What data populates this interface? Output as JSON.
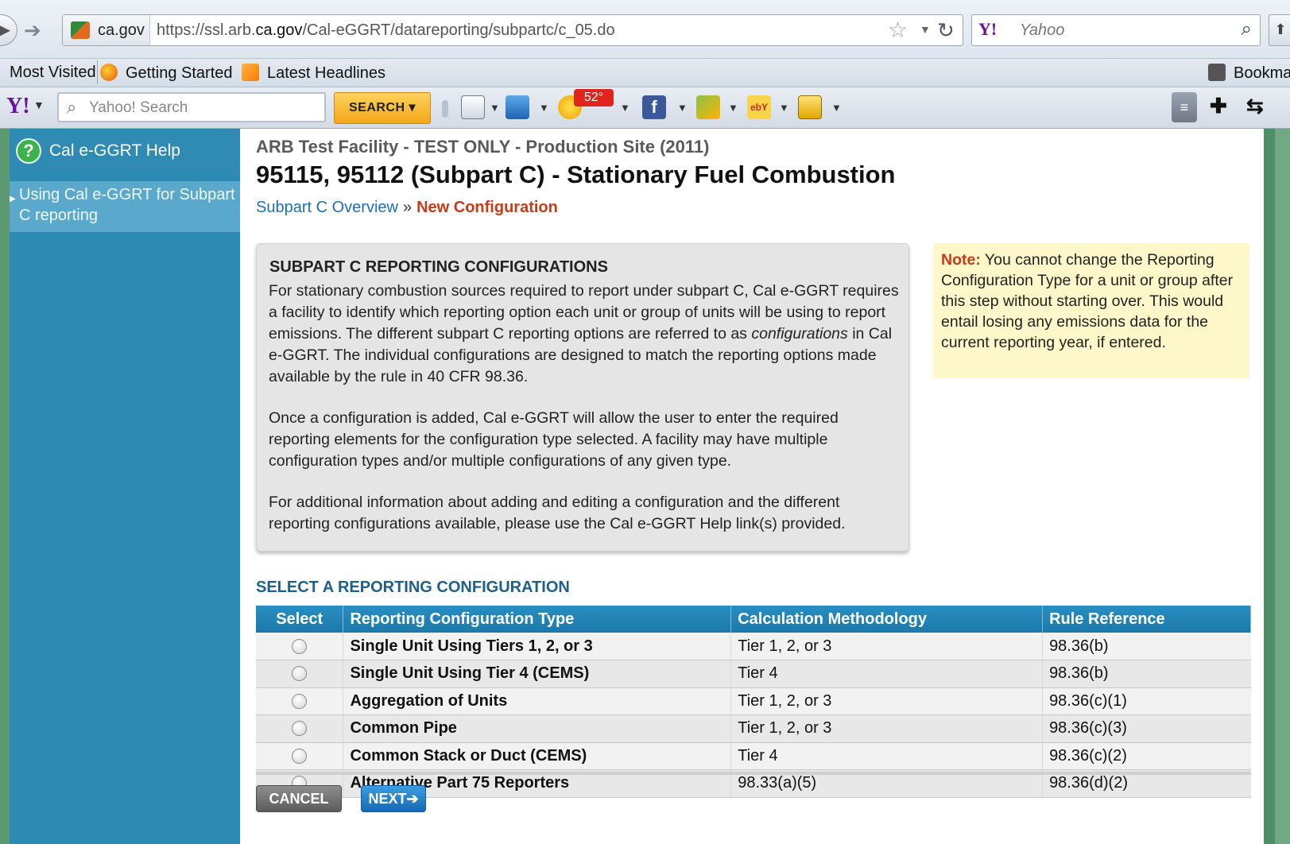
{
  "browser": {
    "site_identity": "ca.gov",
    "url_prefix": "https://ssl.arb.",
    "url_domain": "ca.gov",
    "url_path": "/Cal-eGGRT/datareporting/subpartc/c_05.do",
    "search_engine_logo": "Y!",
    "search_placeholder": "Yahoo",
    "bookmarks": [
      "Most Visited",
      "Getting Started",
      "Latest Headlines"
    ],
    "bookmarks_menu": "Bookma",
    "toolbar": {
      "logo": "Y!",
      "search_placeholder": "Yahoo! Search",
      "search_button": "SEARCH",
      "weather_badge": "52°"
    }
  },
  "sidebar": {
    "help_title": "Cal e-GGRT Help",
    "help_link": "Using Cal e-GGRT for Subpart C reporting"
  },
  "header": {
    "facility": "ARB Test Facility - TEST ONLY - Production Site (2011)",
    "title": "95115, 95112 (Subpart C) - Stationary Fuel Combustion",
    "breadcrumb_link": "Subpart C Overview",
    "breadcrumb_sep": "»",
    "breadcrumb_current": "New Configuration"
  },
  "info_box": {
    "title": "SUBPART C REPORTING CONFIGURATIONS",
    "p1_before": "For stationary combustion sources required to report under subpart C, Cal e-GGRT requires a facility to identify which reporting option each unit or group of units will be using to report emissions. The different subpart C reporting options are referred to as ",
    "p1_italic": "configurations",
    "p1_after": " in Cal e-GGRT. The individual configurations are designed to match the reporting options made available by the rule in 40 CFR 98.36.",
    "p2": "Once a configuration is added, Cal e-GGRT will allow the user to enter the required reporting elements for the configuration type selected. A facility may have multiple configuration types and/or multiple configurations of any given type.",
    "p3": "For additional information about adding and editing a configuration and the different reporting configurations available, please use the Cal e-GGRT Help link(s) provided."
  },
  "note": {
    "label": "Note:",
    "text": " You cannot change the Reporting Configuration Type for a unit or group after this step without starting over. This would entail losing any emissions data for the current reporting year, if entered."
  },
  "selection": {
    "heading": "SELECT A REPORTING CONFIGURATION",
    "columns": [
      "Select",
      "Reporting Configuration Type",
      "Calculation Methodology",
      "Rule Reference"
    ],
    "rows": [
      {
        "type": "Single Unit Using Tiers 1, 2, or 3",
        "method": "Tier 1, 2, or 3",
        "rule": "98.36(b)",
        "selected": false
      },
      {
        "type": "Single Unit Using Tier 4 (CEMS)",
        "method": "Tier 4",
        "rule": "98.36(b)",
        "selected": false
      },
      {
        "type": "Aggregation of Units",
        "method": "Tier 1, 2, or 3",
        "rule": "98.36(c)(1)",
        "selected": false
      },
      {
        "type": "Common Pipe",
        "method": "Tier 1, 2, or 3",
        "rule": "98.36(c)(3)",
        "selected": false
      },
      {
        "type": "Common Stack or Duct (CEMS)",
        "method": "Tier 4",
        "rule": "98.36(c)(2)",
        "selected": false
      },
      {
        "type": "Alternative Part 75 Reporters",
        "method": "98.33(a)(5)",
        "rule": "98.36(d)(2)",
        "selected": false
      }
    ]
  },
  "buttons": {
    "cancel": "CANCEL",
    "next": "NEXT➔"
  },
  "colors": {
    "sidebar": "#2c8ab3",
    "table_header": "#1b79aa",
    "breadcrumb_current": "#c73a1a",
    "note_background": "#fdf7c9"
  }
}
